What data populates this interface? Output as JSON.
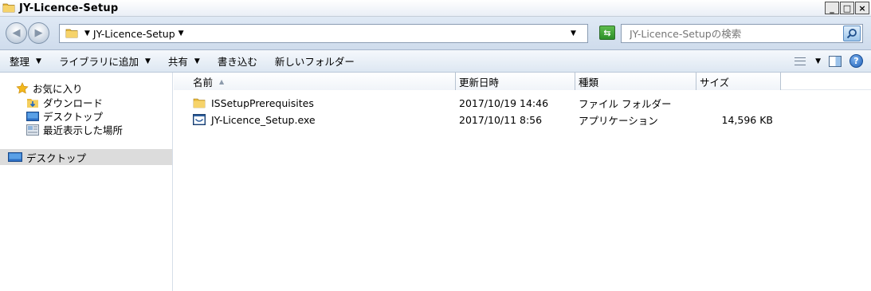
{
  "window": {
    "title": "JY-Licence-Setup",
    "controls": {
      "minimize": "_",
      "maximize": "□",
      "close": "×"
    }
  },
  "address": {
    "crumb": "JY-Licence-Setup",
    "search_placeholder": "JY-Licence-Setupの検索"
  },
  "toolbar": {
    "organize": "整理",
    "add_to_library": "ライブラリに追加",
    "share": "共有",
    "burn": "書き込む",
    "new_folder": "新しいフォルダー"
  },
  "nav": {
    "favorites": "お気に入り",
    "downloads": "ダウンロード",
    "desktop_fav": "デスクトップ",
    "recent_places": "最近表示した場所",
    "desktop": "デスクトップ"
  },
  "columns": {
    "name": "名前",
    "date": "更新日時",
    "type": "種類",
    "size": "サイズ"
  },
  "files": [
    {
      "name": "ISSetupPrerequisites",
      "date": "2017/10/19 14:46",
      "type": "ファイル フォルダー",
      "size": ""
    },
    {
      "name": "JY-Licence_Setup.exe",
      "date": "2017/10/11 8:56",
      "type": "アプリケーション",
      "size": "14,596 KB"
    }
  ],
  "colors": {
    "folder": "#e8b93a",
    "selection": "#dcdcdc",
    "accent": "#1f5fb6"
  }
}
